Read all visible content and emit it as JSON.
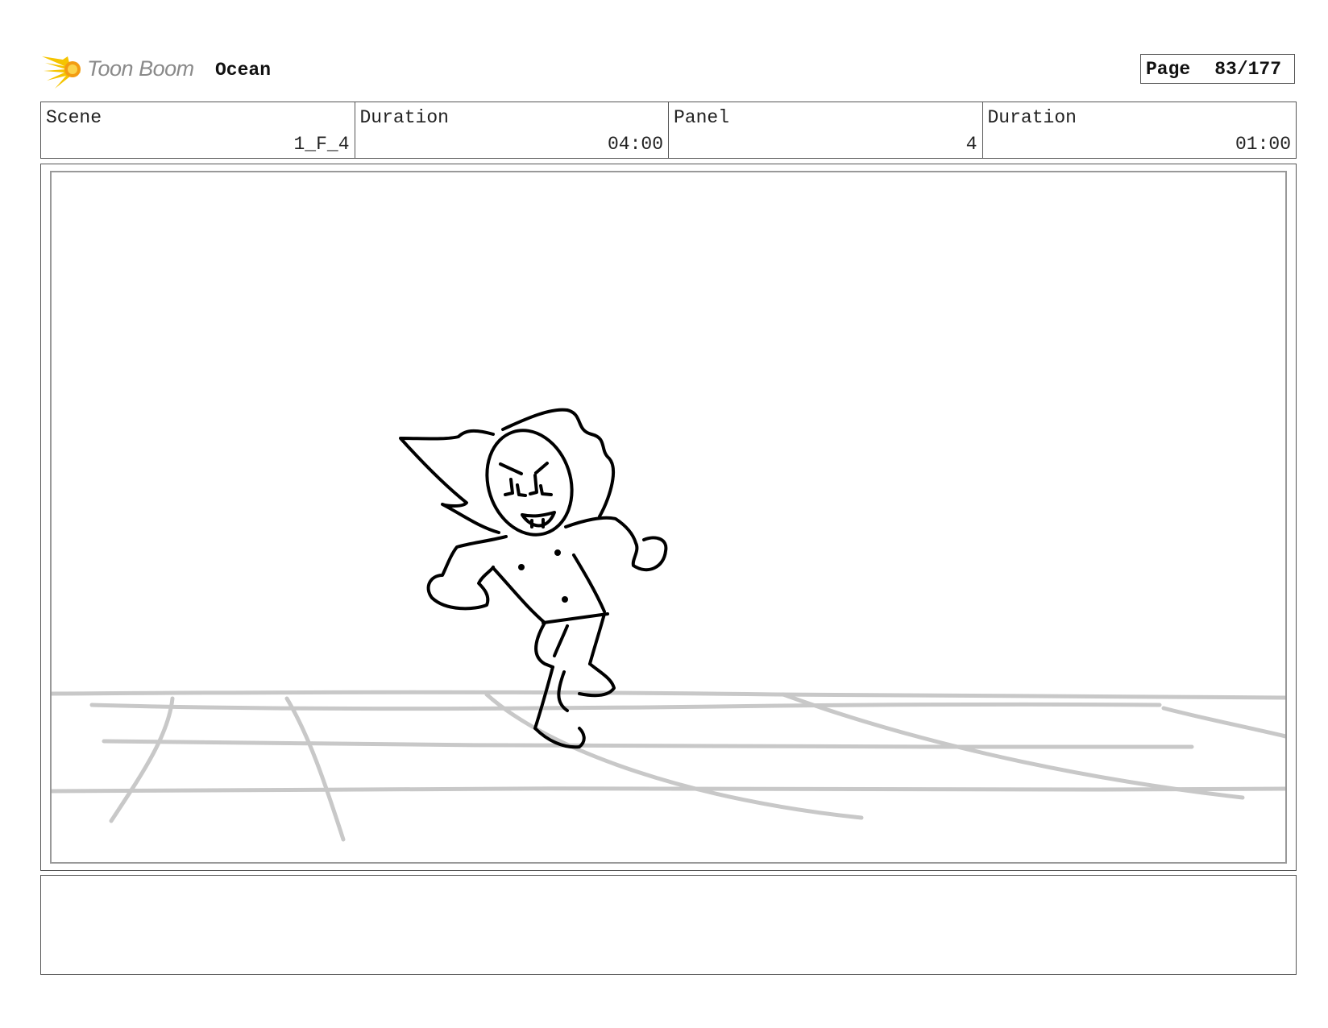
{
  "header": {
    "brand_text": "Toon Boom",
    "project_title": "Ocean",
    "page_label": "Page",
    "page_value": "83/177"
  },
  "info": {
    "scene_label": "Scene",
    "scene_value": "1_F_4",
    "scene_duration_label": "Duration",
    "scene_duration_value": "04:00",
    "panel_label": "Panel",
    "panel_value": "4",
    "panel_duration_label": "Duration",
    "panel_duration_value": "01:00"
  },
  "notes": {
    "text": ""
  },
  "colors": {
    "logo_yellow": "#f5c400",
    "logo_orange": "#f39c12",
    "floor_lines": "#c8c8c8",
    "ink": "#000000"
  }
}
